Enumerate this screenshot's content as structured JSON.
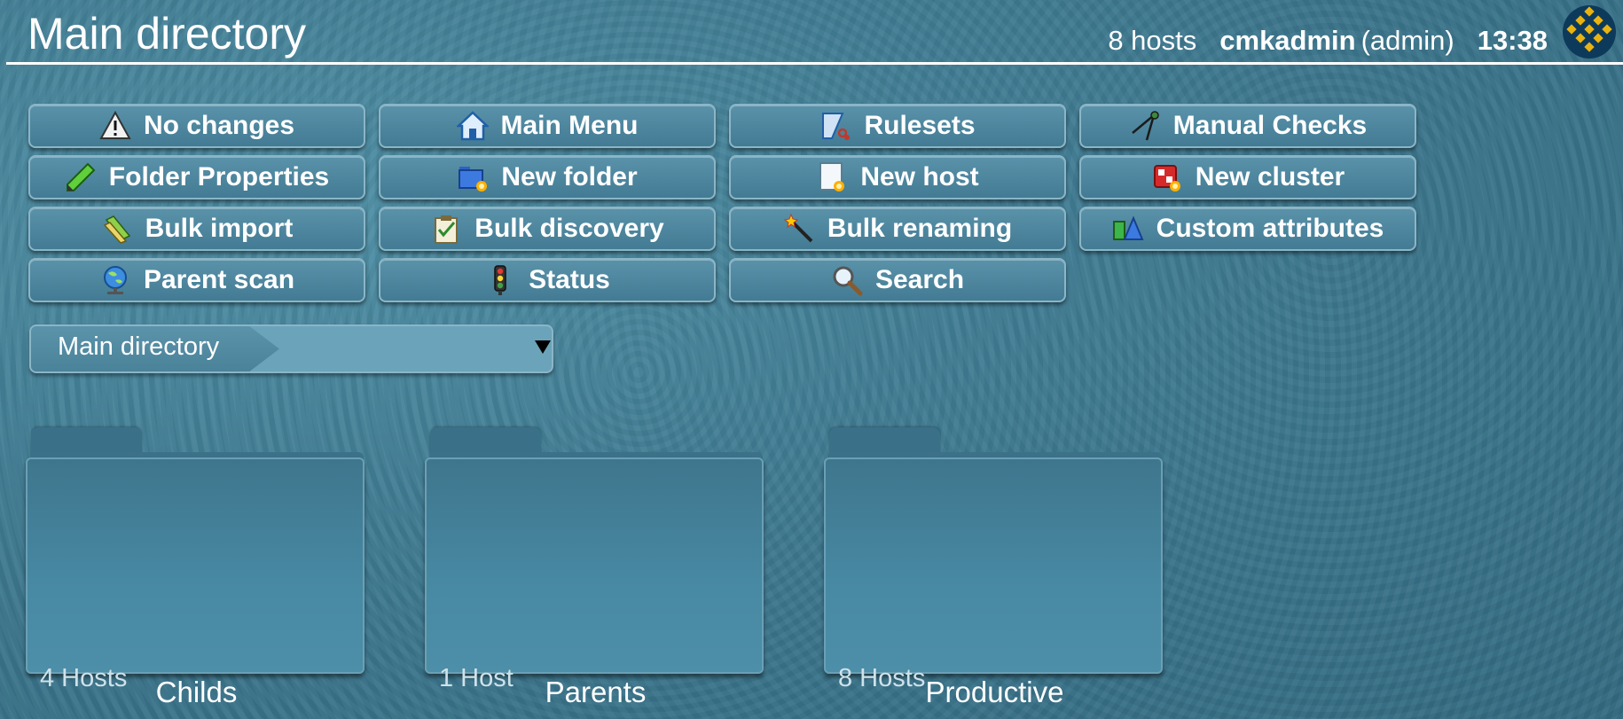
{
  "header": {
    "title": "Main directory",
    "hosts": "8 hosts",
    "user": "cmkadmin",
    "role": "(admin)",
    "time": "13:38"
  },
  "buttons": [
    {
      "label": "No changes",
      "icon": "warning-icon"
    },
    {
      "label": "Main Menu",
      "icon": "home-icon"
    },
    {
      "label": "Rulesets",
      "icon": "rulesets-icon"
    },
    {
      "label": "Manual Checks",
      "icon": "compass-icon"
    },
    {
      "label": "Folder Properties",
      "icon": "pencil-icon"
    },
    {
      "label": "New folder",
      "icon": "new-folder-icon"
    },
    {
      "label": "New host",
      "icon": "new-host-icon"
    },
    {
      "label": "New cluster",
      "icon": "new-cluster-icon"
    },
    {
      "label": "Bulk import",
      "icon": "bulk-import-icon"
    },
    {
      "label": "Bulk discovery",
      "icon": "clipboard-check-icon"
    },
    {
      "label": "Bulk renaming",
      "icon": "magic-wand-icon"
    },
    {
      "label": "Custom attributes",
      "icon": "shapes-icon"
    },
    {
      "label": "Parent scan",
      "icon": "globe-icon"
    },
    {
      "label": "Status",
      "icon": "traffic-light-icon"
    },
    {
      "label": "Search",
      "icon": "magnifier-icon"
    }
  ],
  "breadcrumb": {
    "item": "Main directory"
  },
  "folders": [
    {
      "name": "Childs",
      "count": "4 Hosts"
    },
    {
      "name": "Parents",
      "count": "1 Host"
    },
    {
      "name": "Productive",
      "count": "8 Hosts"
    }
  ],
  "colors": {
    "background": "#3f7a91",
    "button": "#4a839b",
    "accent_border": "#8ab6c7"
  }
}
